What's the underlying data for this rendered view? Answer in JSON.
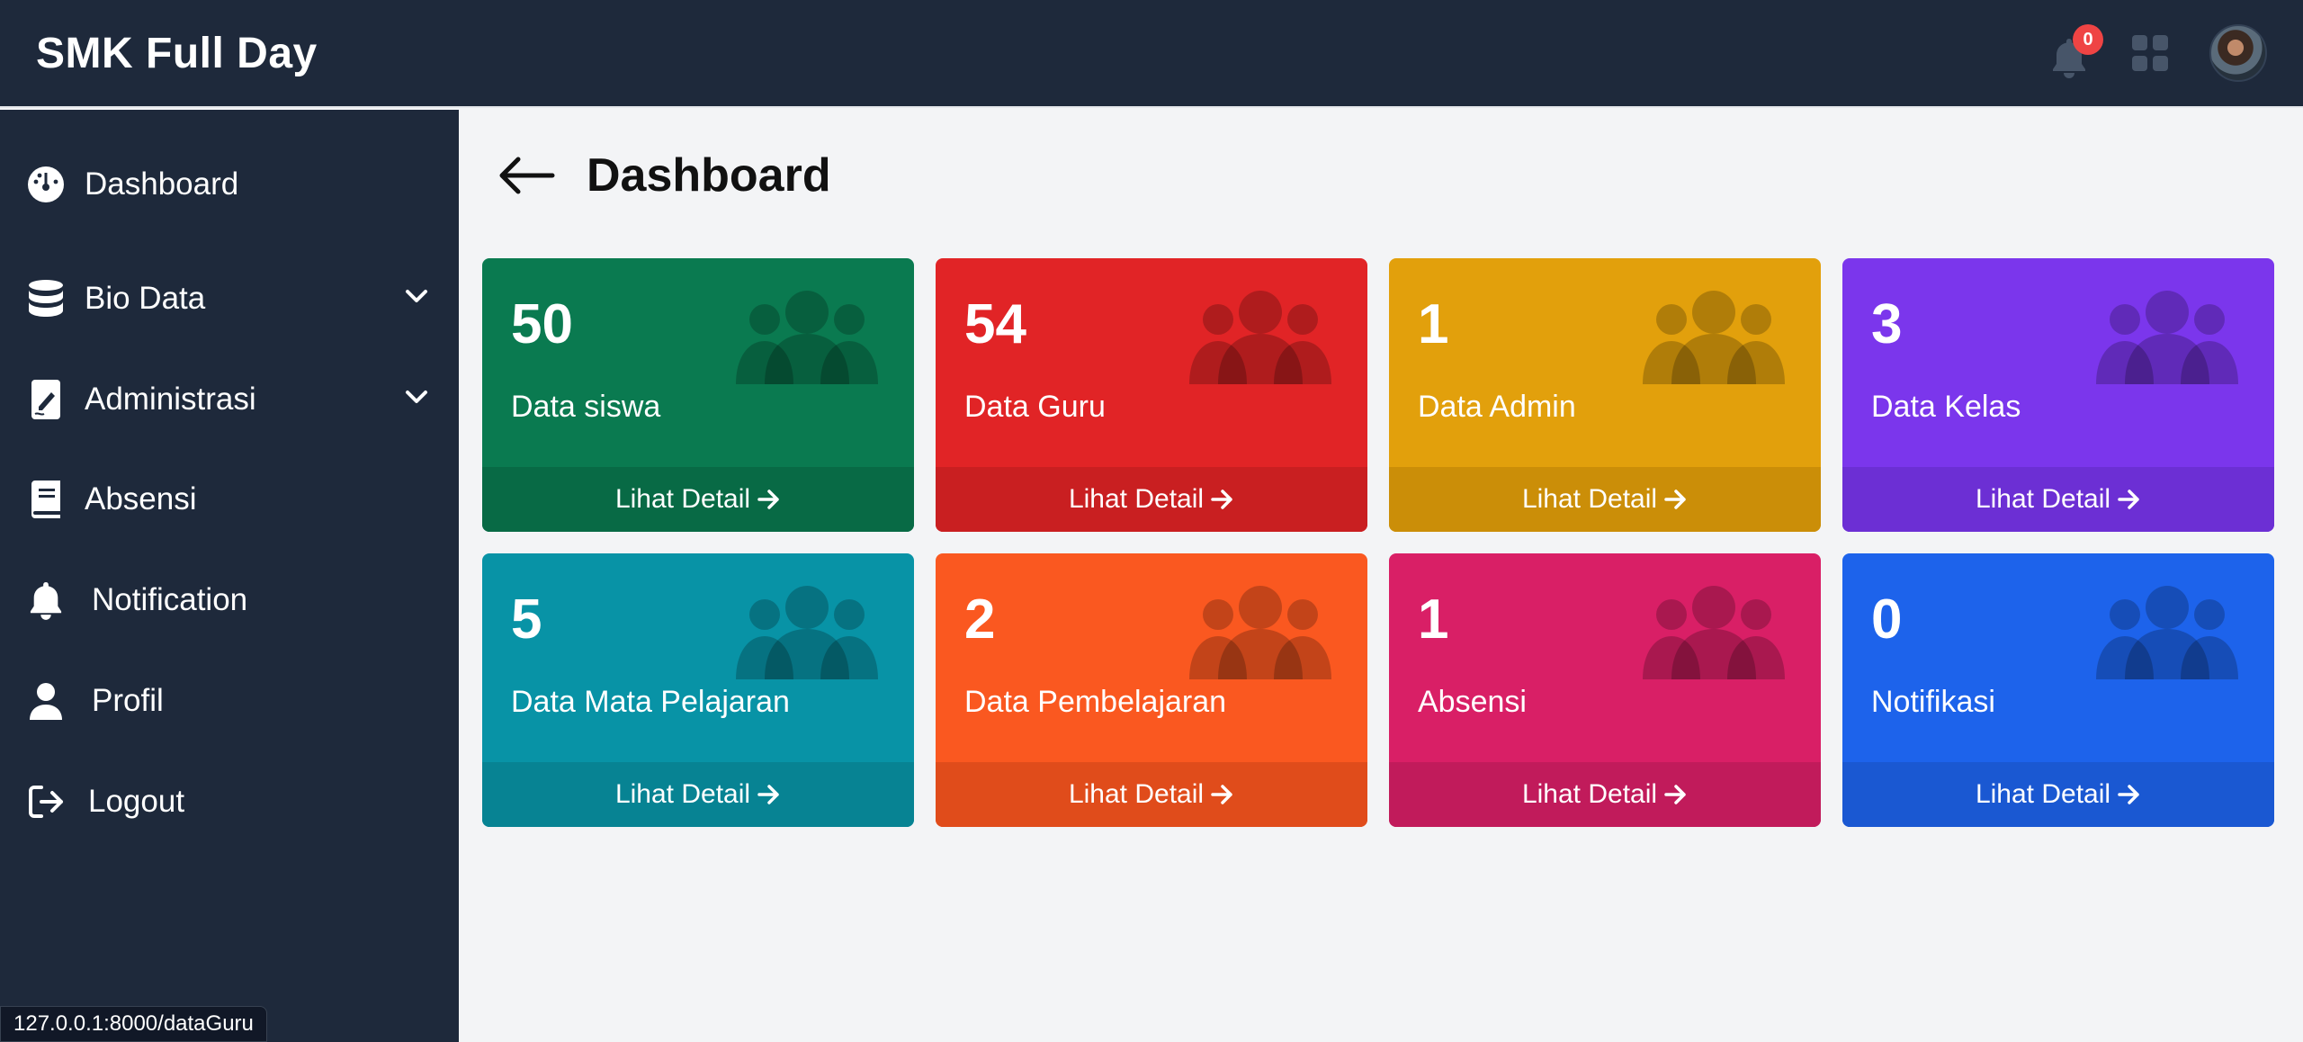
{
  "app": {
    "brand": "SMK Full Day"
  },
  "header": {
    "notification_count": "0"
  },
  "sidebar": {
    "items": [
      {
        "label": "Dashboard",
        "icon": "gauge-icon"
      },
      {
        "label": "Bio Data",
        "icon": "database-icon",
        "has_dropdown": true
      },
      {
        "label": "Administrasi",
        "icon": "file-signature-icon",
        "has_dropdown": true
      },
      {
        "label": "Absensi",
        "icon": "book-icon"
      },
      {
        "label": "Notification",
        "icon": "bell-icon"
      },
      {
        "label": "Profil",
        "icon": "user-icon"
      },
      {
        "label": "Logout",
        "icon": "logout-icon"
      }
    ]
  },
  "main": {
    "title": "Dashboard",
    "cards": [
      {
        "value": "50",
        "label": "Data siswa",
        "link": "Lihat Detail",
        "color": "#0a7a50",
        "footer_color": "#086a45"
      },
      {
        "value": "54",
        "label": "Data Guru",
        "link": "Lihat Detail",
        "color": "#e12426",
        "footer_color": "#c91f21"
      },
      {
        "value": "1",
        "label": "Data Admin",
        "link": "Lihat Detail",
        "color": "#e2a00c",
        "footer_color": "#cb8e08"
      },
      {
        "value": "3",
        "label": "Data Kelas",
        "link": "Lihat Detail",
        "color": "#7b36ec",
        "footer_color": "#6c2fd4"
      },
      {
        "value": "5",
        "label": "Data Mata Pelajaran",
        "link": "Lihat Detail",
        "color": "#0893a6",
        "footer_color": "#078393"
      },
      {
        "value": "2",
        "label": "Data Pembelajaran",
        "link": "Lihat Detail",
        "color": "#fa5820",
        "footer_color": "#e04c1b"
      },
      {
        "value": "1",
        "label": "Absensi",
        "link": "Lihat Detail",
        "color": "#d91f66",
        "footer_color": "#c11b5b"
      },
      {
        "value": "0",
        "label": "Notifikasi",
        "link": "Lihat Detail",
        "color": "#1d63eb",
        "footer_color": "#1a58d2"
      }
    ]
  },
  "statusbar": {
    "url": "127.0.0.1:8000/dataGuru"
  }
}
